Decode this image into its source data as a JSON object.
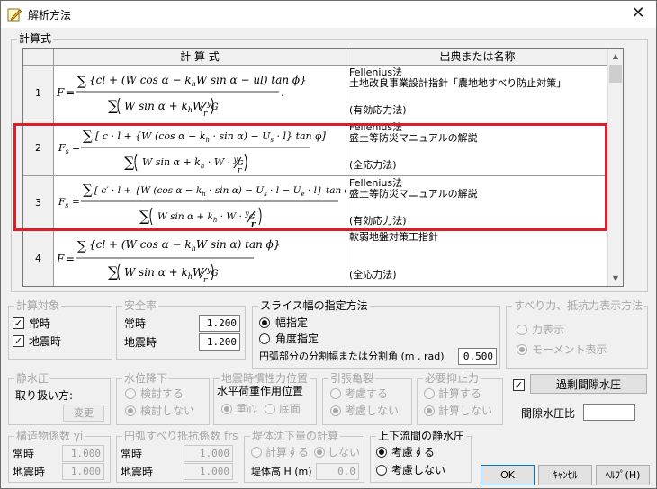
{
  "window": {
    "title": "解析方法",
    "close_glyph": "✕"
  },
  "formula_group": {
    "title": "計算式",
    "headers": {
      "formula": "計 算 式",
      "source": "出典または名称"
    },
    "rows": [
      {
        "num": "1",
        "source_lines": [
          "Fellenius法",
          "土地改良事業設計指針「農地地すべり防止対策」",
          "",
          "(有効応力法)"
        ]
      },
      {
        "num": "2",
        "source_lines": [
          "Fellenius法",
          "盛土等防災マニュアルの解説",
          "",
          "(全応力法)"
        ]
      },
      {
        "num": "3",
        "source_lines": [
          "Fellenius法",
          "盛土等防災マニュアルの解説",
          "",
          "(有効応力法)"
        ]
      },
      {
        "num": "4",
        "source_lines": [
          "軟弱地盤対策工指針",
          "",
          "",
          "(全応力法)"
        ]
      }
    ],
    "scroll": {
      "up": "▲",
      "down": "▼"
    }
  },
  "calc_target": {
    "title": "計算対象",
    "normal": "常時",
    "quake": "地震時",
    "normal_checked": true,
    "quake_checked": true,
    "check_glyph": "✓"
  },
  "safety_factor": {
    "title": "安全率",
    "normal_label": "常時",
    "normal_value": "1.200",
    "quake_label": "地震時",
    "quake_value": "1.200"
  },
  "slice": {
    "title": "スライス幅の指定方法",
    "opt1": "幅指定",
    "opt2": "角度指定",
    "div_label": "円弧部分の分割幅または分割角 (m , rad)",
    "div_value": "0.500"
  },
  "disp": {
    "title": "すべり力、抵抗力表示方法",
    "opt1": "力表示",
    "opt2": "モーメント表示"
  },
  "static_water": {
    "title": "静水圧",
    "label": "取り扱い方:",
    "button": "変更"
  },
  "water_drop": {
    "title": "水位降下",
    "opt1": "検討する",
    "opt2": "検討しない"
  },
  "inertia": {
    "title": "地震時慣性力位置",
    "sub": "水平荷重作用位置",
    "opt1": "重心",
    "opt2": "底面"
  },
  "crack": {
    "title": "引張亀裂",
    "opt1": "考慮する",
    "opt2": "考慮しない"
  },
  "required": {
    "title": "必要抑止力",
    "opt1": "計算する",
    "opt2": "計算しない"
  },
  "pore": {
    "checked": true,
    "button": "過剰間隙水圧",
    "ratio_label": "間隙水圧比",
    "ratio_value": ""
  },
  "structure": {
    "title": "構造物係数 γi",
    "normal_label": "常時",
    "normal_value": "1.000",
    "quake_label": "地震時",
    "quake_value": "1.000"
  },
  "arc": {
    "title": "円弧すべり抵抗係数 frs",
    "normal_label": "常時",
    "normal_value": "1.000",
    "quake_label": "地震時",
    "quake_value": "1.000"
  },
  "settle": {
    "title": "堤体沈下量の計算",
    "opt1": "計算する",
    "opt2": "しない",
    "height_label": "堤体高 H (m)",
    "height_value": "0.0"
  },
  "updown": {
    "title": "上下流間の静水圧",
    "opt1": "考慮する",
    "opt2": "考慮しない"
  },
  "buttons": {
    "ok": "OK",
    "cancel": "ｷｬﾝｾﾙ",
    "help": "ﾍﾙﾌﾟ(H)"
  }
}
